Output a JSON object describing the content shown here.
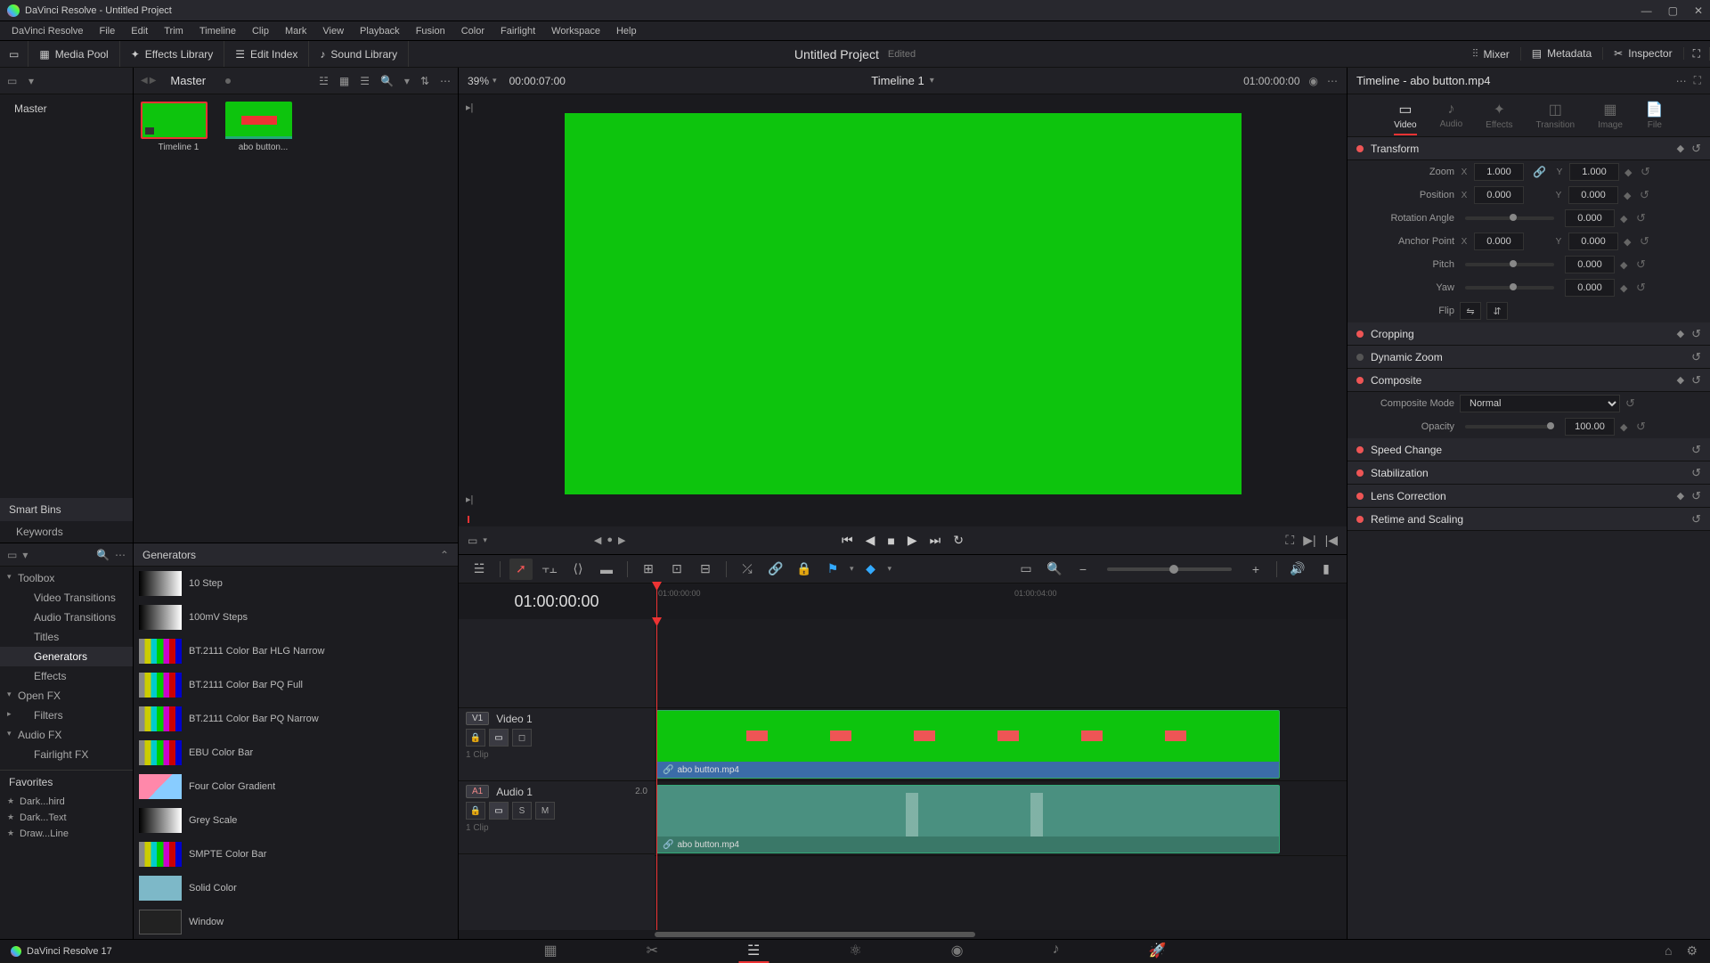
{
  "titlebar": {
    "title": "DaVinci Resolve - Untitled Project"
  },
  "menubar": [
    "DaVinci Resolve",
    "File",
    "Edit",
    "Trim",
    "Timeline",
    "Clip",
    "Mark",
    "View",
    "Playback",
    "Fusion",
    "Color",
    "Fairlight",
    "Workspace",
    "Help"
  ],
  "toolbar": {
    "media_pool": "Media Pool",
    "effects_library": "Effects Library",
    "edit_index": "Edit Index",
    "sound_library": "Sound Library",
    "project_title": "Untitled Project",
    "edited": "Edited",
    "mixer": "Mixer",
    "metadata": "Metadata",
    "inspector": "Inspector"
  },
  "mediapool": {
    "master": "Master",
    "tree_master": "Master",
    "smart_bins": "Smart Bins",
    "keywords": "Keywords",
    "thumbs": [
      {
        "label": "Timeline 1"
      },
      {
        "label": "abo button..."
      }
    ]
  },
  "viewer": {
    "zoom": "39%",
    "timecode_in": "00:00:07:00",
    "timeline_name": "Timeline 1",
    "timecode_right": "01:00:00:00"
  },
  "fxlib": {
    "toolbox": "Toolbox",
    "video_transitions": "Video Transitions",
    "audio_transitions": "Audio Transitions",
    "titles": "Titles",
    "generators": "Generators",
    "effects": "Effects",
    "openfx": "Open FX",
    "filters": "Filters",
    "audiofx": "Audio FX",
    "fairlightfx": "Fairlight FX",
    "favorites": "Favorites",
    "fav_items": [
      "Dark...hird",
      "Dark...Text",
      "Draw...Line"
    ],
    "section_title": "Generators",
    "items": [
      "10 Step",
      "100mV Steps",
      "BT.2111 Color Bar HLG Narrow",
      "BT.2111 Color Bar PQ Full",
      "BT.2111 Color Bar PQ Narrow",
      "EBU Color Bar",
      "Four Color Gradient",
      "Grey Scale",
      "SMPTE Color Bar",
      "Solid Color",
      "Window"
    ]
  },
  "timeline": {
    "timecode": "01:00:00:00",
    "ticks": [
      "01:00:00:00",
      "01:00:04:00"
    ],
    "video_track": {
      "badge": "V1",
      "name": "Video 1",
      "clips": "1 Clip"
    },
    "audio_track": {
      "badge": "A1",
      "name": "Audio 1",
      "db": "2.0",
      "clips": "1 Clip"
    },
    "clip_name": "abo button.mp4"
  },
  "inspector": {
    "title": "Timeline - abo button.mp4",
    "tabs": [
      "Video",
      "Audio",
      "Effects",
      "Transition",
      "Image",
      "File"
    ],
    "transform": {
      "title": "Transform",
      "zoom": "Zoom",
      "zoom_x": "1.000",
      "zoom_y": "1.000",
      "position": "Position",
      "pos_x": "0.000",
      "pos_y": "0.000",
      "rotation": "Rotation Angle",
      "rotation_v": "0.000",
      "anchor": "Anchor Point",
      "anchor_x": "0.000",
      "anchor_y": "0.000",
      "pitch": "Pitch",
      "pitch_v": "0.000",
      "yaw": "Yaw",
      "yaw_v": "0.000",
      "flip": "Flip"
    },
    "cropping": "Cropping",
    "dynamic_zoom": "Dynamic Zoom",
    "composite": {
      "title": "Composite",
      "mode_lbl": "Composite Mode",
      "mode_v": "Normal",
      "opacity_lbl": "Opacity",
      "opacity_v": "100.00"
    },
    "speed_change": "Speed Change",
    "stabilization": "Stabilization",
    "lens_correction": "Lens Correction",
    "retime": "Retime and Scaling"
  },
  "footer": {
    "app": "DaVinci Resolve 17"
  }
}
